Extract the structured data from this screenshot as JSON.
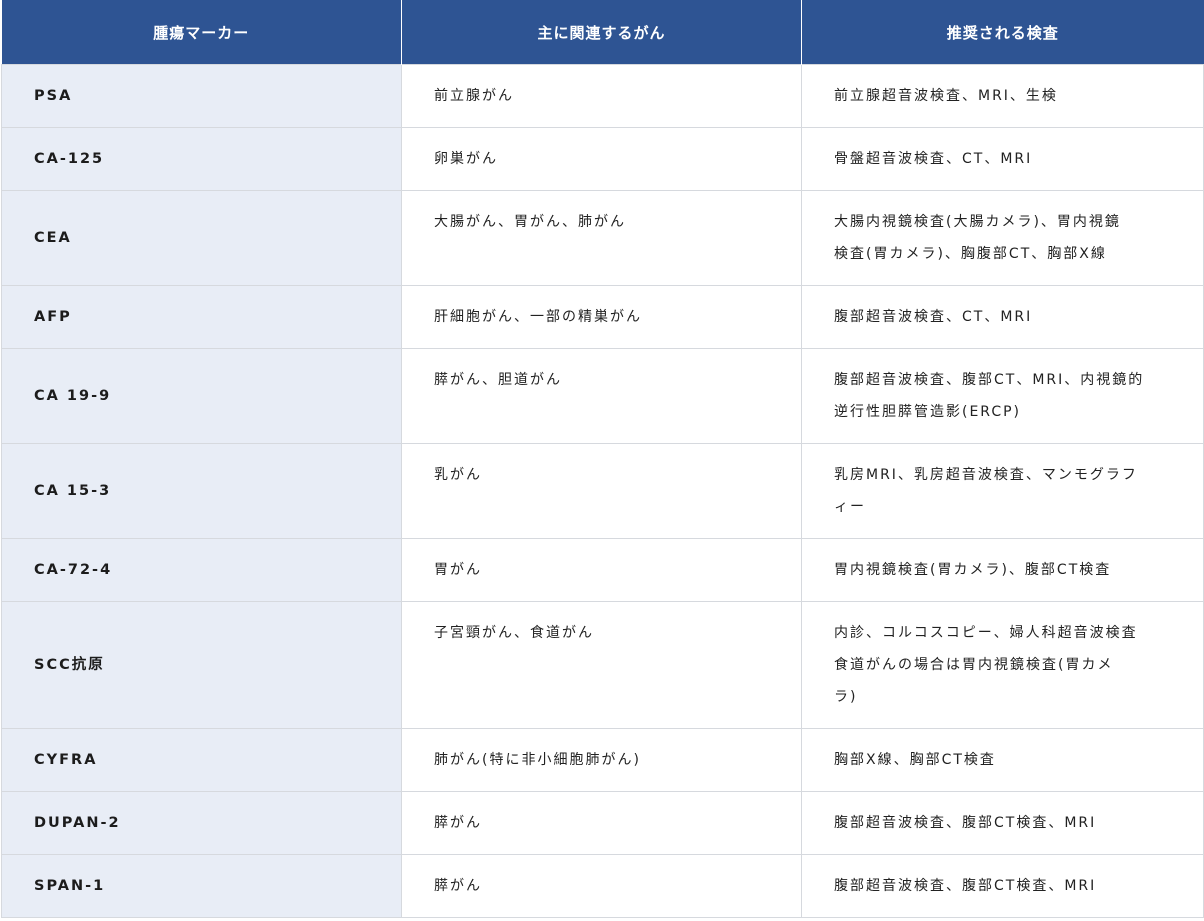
{
  "table": {
    "headers": [
      "腫瘍マーカー",
      "主に関連するがん",
      "推奨される検査"
    ],
    "rows": [
      {
        "marker": "PSA",
        "cancer": "前立腺がん",
        "tests": [
          "前立腺超音波検査、MRI、生検"
        ]
      },
      {
        "marker": "CA-125",
        "cancer": "卵巣がん",
        "tests": [
          "骨盤超音波検査、CT、MRI"
        ]
      },
      {
        "marker": "CEA",
        "cancer": "大腸がん、胃がん、肺がん",
        "tests": [
          "大腸内視鏡検査(大腸カメラ)、胃内視鏡",
          "検査(胃カメラ)、胸腹部CT、胸部X線"
        ]
      },
      {
        "marker": "AFP",
        "cancer": "肝細胞がん、一部の精巣がん",
        "tests": [
          "腹部超音波検査、CT、MRI"
        ]
      },
      {
        "marker": "CA 19-9",
        "cancer": "膵がん、胆道がん",
        "tests": [
          "腹部超音波検査、腹部CT、MRI、内視鏡的",
          "逆行性胆膵管造影(ERCP)"
        ]
      },
      {
        "marker": "CA 15-3",
        "cancer": "乳がん",
        "tests": [
          "乳房MRI、乳房超音波検査、マンモグラフ",
          "ィー"
        ]
      },
      {
        "marker": "CA-72-4",
        "cancer": "胃がん",
        "tests": [
          "胃内視鏡検査(胃カメラ)、腹部CT検査"
        ]
      },
      {
        "marker": "SCC抗原",
        "cancer": "子宮頸がん、食道がん",
        "tests": [
          "内診、コルコスコピー、婦人科超音波検査",
          "食道がんの場合は胃内視鏡検査(胃カメ",
          "ラ)"
        ]
      },
      {
        "marker": "CYFRA",
        "cancer": "肺がん(特に非小細胞肺がん)",
        "tests": [
          "胸部X線、胸部CT検査"
        ]
      },
      {
        "marker": "DUPAN-2",
        "cancer": "膵がん",
        "tests": [
          "腹部超音波検査、腹部CT検査、MRI"
        ]
      },
      {
        "marker": "SPAN-1",
        "cancer": "膵がん",
        "tests": [
          "腹部超音波検査、腹部CT検査、MRI"
        ]
      }
    ]
  },
  "colors": {
    "header_bg": "#2e5493",
    "header_text": "#ffffff",
    "marker_col_bg": "#e8edf6",
    "border": "#d6d9de"
  }
}
